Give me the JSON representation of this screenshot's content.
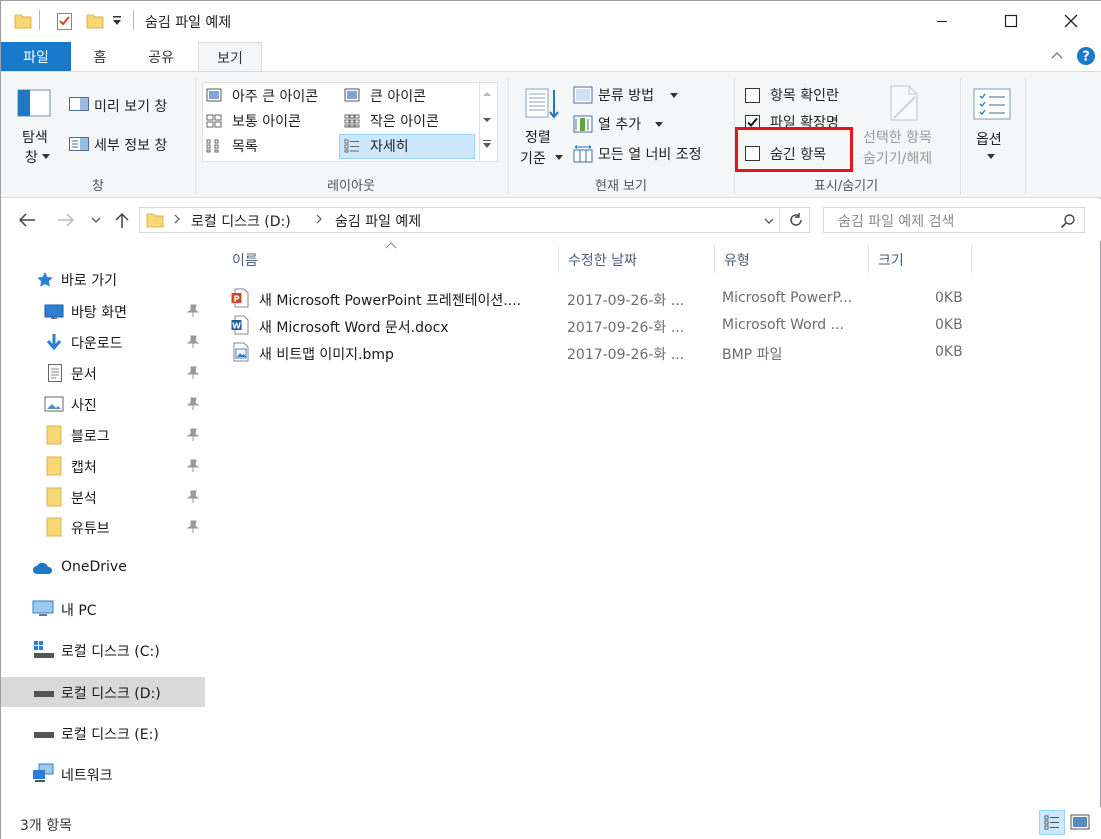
{
  "window": {
    "title": "숨김 파일 예제"
  },
  "tabs": [
    {
      "label": "파일"
    },
    {
      "label": "홈"
    },
    {
      "label": "공유"
    },
    {
      "label": "보기"
    }
  ],
  "ribbon": {
    "pane_group": {
      "nav_pane_label_line1": "탐색",
      "nav_pane_label_line2": "창",
      "preview_pane": "미리 보기 창",
      "details_pane": "세부 정보 창",
      "group_label": "창"
    },
    "layout_group": {
      "items": [
        "아주 큰 아이콘",
        "큰 아이콘",
        "보통 아이콘",
        "작은 아이콘",
        "목록",
        "자세히"
      ],
      "selected": "자세히",
      "group_label": "레이아웃"
    },
    "current_view_group": {
      "sort_line1": "정렬",
      "sort_line2": "기준",
      "group_by": "분류 방법",
      "add_columns": "열 추가",
      "size_all_columns": "모든 열 너비 조정",
      "group_label": "현재 보기"
    },
    "show_hide_group": {
      "item_checkboxes": "항목 확인란",
      "file_extensions": "파일 확장명",
      "hidden_items": "숨긴 항목",
      "item_checkboxes_checked": false,
      "file_extensions_checked": true,
      "hidden_items_checked": false,
      "hide_selected_line1": "선택한 항목",
      "hide_selected_line2": "숨기기/해제",
      "group_label": "표시/숨기기"
    },
    "options": {
      "label": "옵션"
    }
  },
  "address": {
    "crumbs": [
      "로컬 디스크 (D:)",
      "숨김 파일 예제"
    ],
    "search_placeholder": "숨김 파일 예제 검색"
  },
  "nav": {
    "quick_access": "바로 가기",
    "items": [
      {
        "label": "바탕 화면",
        "pinned": true
      },
      {
        "label": "다운로드",
        "pinned": true
      },
      {
        "label": "문서",
        "pinned": true
      },
      {
        "label": "사진",
        "pinned": true
      },
      {
        "label": "블로그",
        "pinned": true
      },
      {
        "label": "캡처",
        "pinned": true
      },
      {
        "label": "분석",
        "pinned": true
      },
      {
        "label": "유튜브",
        "pinned": true
      }
    ],
    "onedrive": "OneDrive",
    "this_pc": "내 PC",
    "drives": [
      "로컬 디스크 (C:)",
      "로컬 디스크 (D:)",
      "로컬 디스크 (E:)"
    ],
    "selected_drive": "로컬 디스크 (D:)",
    "network": "네트워크"
  },
  "columns": {
    "name": "이름",
    "modified": "수정한 날짜",
    "type": "유형",
    "size": "크기"
  },
  "files": [
    {
      "name": "새 Microsoft PowerPoint 프레젠테이션....",
      "modified": "2017-09-26-화 ...",
      "type": "Microsoft PowerP...",
      "size": "0KB",
      "icon": "powerpoint-file-icon"
    },
    {
      "name": "새 Microsoft Word 문서.docx",
      "modified": "2017-09-26-화 ...",
      "type": "Microsoft Word ...",
      "size": "0KB",
      "icon": "word-file-icon"
    },
    {
      "name": "새 비트맵 이미지.bmp",
      "modified": "2017-09-26-화 ...",
      "type": "BMP 파일",
      "size": "0KB",
      "icon": "bitmap-file-icon"
    }
  ],
  "status": {
    "item_count": "3개 항목"
  },
  "colors": {
    "file_tab": "#1979ca",
    "highlight": "#e5141a",
    "ribbon_bg": "#f5f6f7",
    "selected_bg": "#d9d9d9"
  }
}
